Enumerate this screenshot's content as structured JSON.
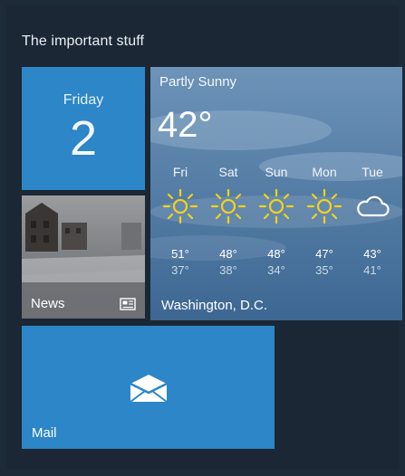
{
  "group": {
    "title": "The important stuff"
  },
  "calendar": {
    "day": "Friday",
    "date": "2"
  },
  "news": {
    "label": "News",
    "icon": "newspaper-icon"
  },
  "weather": {
    "condition": "Partly Sunny",
    "temperature": "42°",
    "location": "Washington, D.C.",
    "forecast": [
      {
        "day": "Fri",
        "icon": "sun-icon",
        "high": "51°",
        "low": "37°"
      },
      {
        "day": "Sat",
        "icon": "sun-icon",
        "high": "48°",
        "low": "38°"
      },
      {
        "day": "Sun",
        "icon": "sun-icon",
        "high": "48°",
        "low": "34°"
      },
      {
        "day": "Mon",
        "icon": "sun-icon",
        "high": "47°",
        "low": "35°"
      },
      {
        "day": "Tue",
        "icon": "cloud-icon",
        "high": "43°",
        "low": "41°"
      }
    ]
  },
  "mail": {
    "label": "Mail",
    "icon": "mail-envelope-icon"
  },
  "colors": {
    "tile_blue": "#2c86c7",
    "sun_yellow": "#f2d21a",
    "background": "#1b2735"
  }
}
